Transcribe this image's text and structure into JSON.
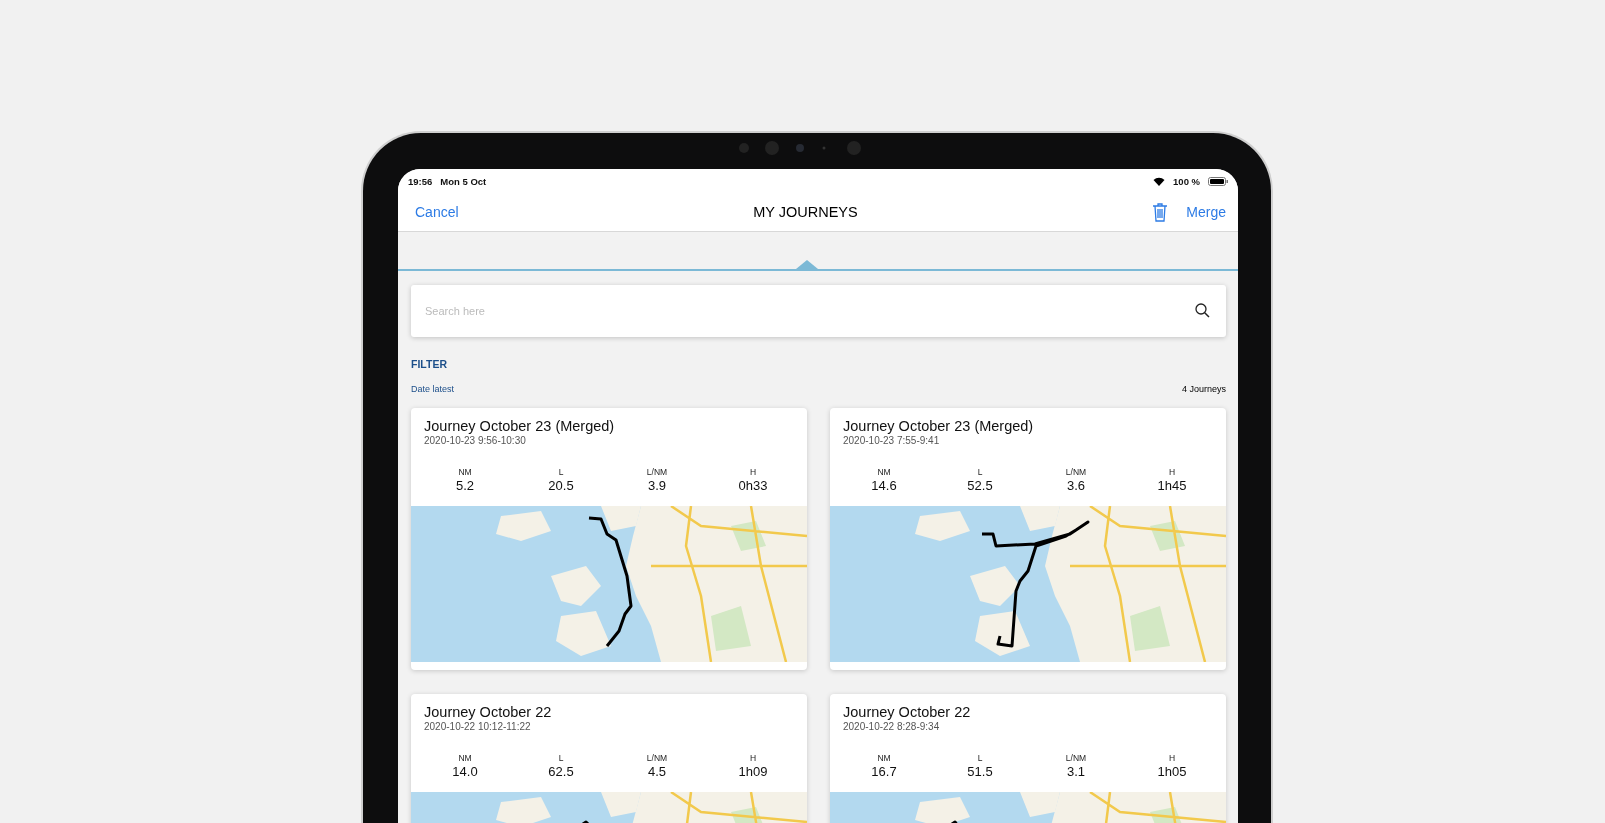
{
  "status_bar": {
    "time": "19:56",
    "date": "Mon 5 Oct",
    "battery": "100 %"
  },
  "nav": {
    "cancel": "Cancel",
    "title": "MY JOURNEYS",
    "merge": "Merge"
  },
  "search": {
    "placeholder": "Search here"
  },
  "filter": {
    "heading": "FILTER",
    "sort": "Date latest",
    "count": "4 Journeys"
  },
  "journeys": [
    {
      "title": "Journey October 23 (Merged)",
      "time": "2020-10-23 9:56-10:30",
      "stats": [
        {
          "label": "NM",
          "value": "5.2"
        },
        {
          "label": "L",
          "value": "20.5"
        },
        {
          "label": "L/NM",
          "value": "3.9"
        },
        {
          "label": "H",
          "value": "0h33"
        }
      ]
    },
    {
      "title": "Journey October 23 (Merged)",
      "time": "2020-10-23 7:55-9:41",
      "stats": [
        {
          "label": "NM",
          "value": "14.6"
        },
        {
          "label": "L",
          "value": "52.5"
        },
        {
          "label": "L/NM",
          "value": "3.6"
        },
        {
          "label": "H",
          "value": "1h45"
        }
      ]
    },
    {
      "title": "Journey October 22",
      "time": "2020-10-22 10:12-11:22",
      "stats": [
        {
          "label": "NM",
          "value": "14.0"
        },
        {
          "label": "L",
          "value": "62.5"
        },
        {
          "label": "L/NM",
          "value": "4.5"
        },
        {
          "label": "H",
          "value": "1h09"
        }
      ]
    },
    {
      "title": "Journey October 22",
      "time": "2020-10-22 8:28-9:34",
      "stats": [
        {
          "label": "NM",
          "value": "16.7"
        },
        {
          "label": "L",
          "value": "51.5"
        },
        {
          "label": "L/NM",
          "value": "3.1"
        },
        {
          "label": "H",
          "value": "1h05"
        }
      ]
    }
  ]
}
